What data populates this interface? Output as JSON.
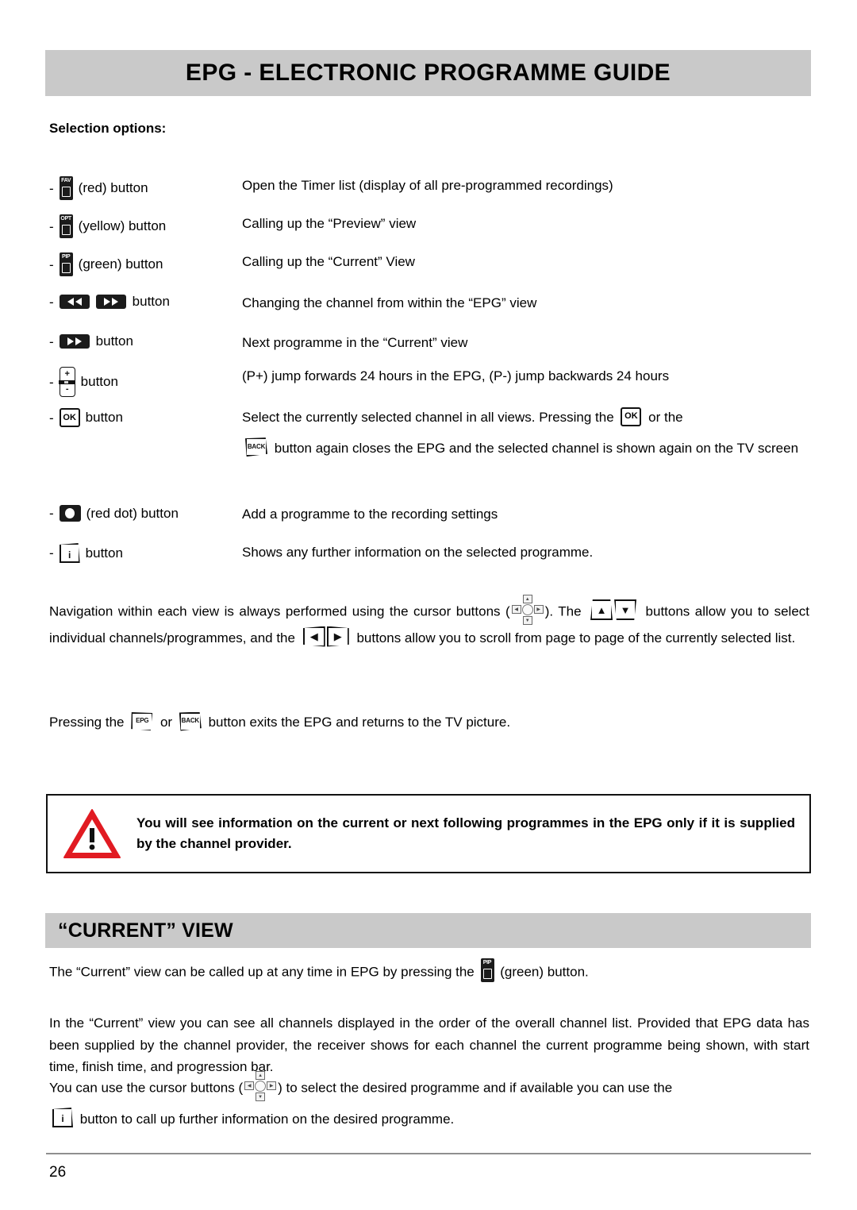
{
  "header": {
    "title": "EPG - ELECTRONIC PROGRAMME GUIDE",
    "subhead": "Selection options:"
  },
  "colors": {
    "band_background": "#c9c9c9",
    "warning_red": "#e11b22",
    "key_black": "#1b1b1b",
    "text": "#000000",
    "rule": "#8f8f8f"
  },
  "options": [
    {
      "icon": "fav-colour-key",
      "icon_label": "FAV",
      "label": "(red) button",
      "description": "Open the Timer list (display of all pre-programmed recordings)"
    },
    {
      "icon": "opt-colour-key",
      "icon_label": "OPT",
      "label": "(yellow) button",
      "description": "Calling up the “Preview” view"
    },
    {
      "icon": "pip-colour-key",
      "icon_label": "PIP",
      "label": "(green) button",
      "description": "Calling up the “Current” View"
    },
    {
      "icon": "rewind-forward-keys",
      "label": "button",
      "description": "Changing the channel from within the “EPG” view"
    },
    {
      "icon": "forward-key",
      "label": "button",
      "description": "Next programme in the “Current” view"
    },
    {
      "icon": "programme-rocker-key",
      "icon_plus": "+",
      "icon_minus": "-",
      "label": "button",
      "description": "(P+) jump forwards 24 hours in the EPG, (P-) jump backwards 24 hours"
    },
    {
      "icon": "ok-key",
      "icon_label": "OK",
      "label": "button",
      "description_part1": "Select the currently selected channel in all views. Pressing the",
      "description_part2": "or the",
      "description_part3": "button again closes the EPG and the selected channel is shown again on the TV screen",
      "inline_ok_label": "OK",
      "inline_back_label": "BACK"
    },
    {
      "icon": "record-dot-key",
      "label": "(red dot) button",
      "description": "Add a programme to the recording settings"
    },
    {
      "icon": "info-key",
      "icon_label": "i",
      "label": "button",
      "description": "Shows any further information on the selected programme."
    }
  ],
  "navigation_paragraph": {
    "part1": "Navigation within each view is always performed using the cursor buttons (",
    "part2": "). The",
    "part3": "buttons allow you to select individual channels/programmes, and the",
    "part4": "buttons allow you to scroll from page to page of the currently selected list."
  },
  "exit_paragraph": {
    "part1": "Pressing the",
    "part2": "or",
    "part3": "button exits the EPG and returns to the TV picture.",
    "epg_key_label": "EPG",
    "back_key_label": "BACK"
  },
  "warning": {
    "icon": "warning-triangle-icon",
    "exclamation": "!",
    "text": "You will see information on the current or next following programmes in the EPG only if it is supplied by the channel provider."
  },
  "section": {
    "title": "“CURRENT” VIEW",
    "paragraph1_part1": "The “Current” view can be called up at any time in EPG by pressing the",
    "paragraph1_part2": "(green) button.",
    "paragraph1_key_label": "PIP",
    "paragraph2": "In the “Current” view you can see all channels displayed in the order of the overall channel list. Provided that EPG data has been supplied by the channel provider, the receiver shows for each channel the current programme being shown, with start time, finish time, and progression bar.",
    "paragraph3_part1": "You can use the cursor buttons (",
    "paragraph3_part2": ") to select the desired programme and if available you can use the",
    "paragraph3_part3": "button to call up further information on the desired programme.",
    "paragraph3_info_label": "i"
  },
  "footer": {
    "page_number": "26"
  }
}
